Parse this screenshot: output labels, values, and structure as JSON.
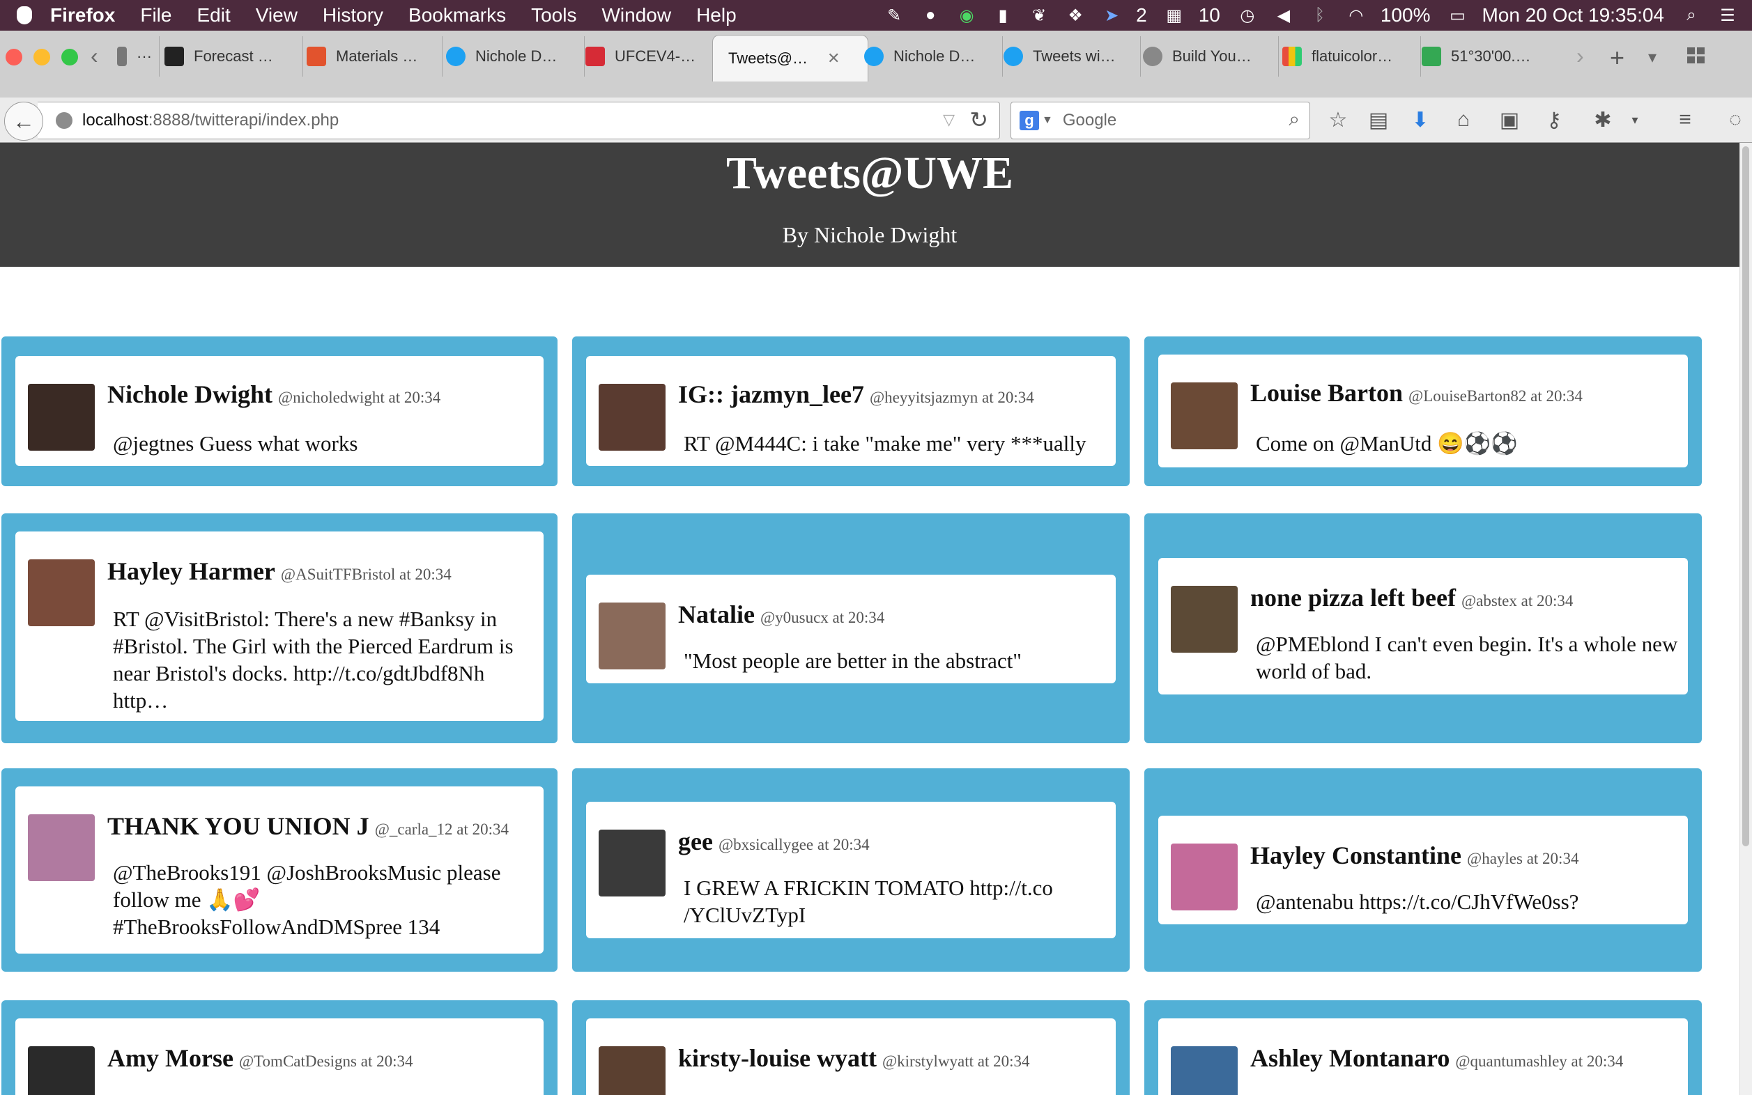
{
  "menubar": {
    "app": "Firefox",
    "menus": [
      "File",
      "Edit",
      "View",
      "History",
      "Bookmarks",
      "Tools",
      "Window",
      "Help"
    ],
    "tray_count_a": "2",
    "tray_count_b": "10",
    "battery": "100%",
    "clock": "Mon 20 Oct  19:35:04"
  },
  "tabs": [
    {
      "label": "···",
      "color": "#777777"
    },
    {
      "label": "Forecast …",
      "color": "#222222"
    },
    {
      "label": "Materials …",
      "color": "#e2532d"
    },
    {
      "label": "Nichole D…",
      "color": "#1da1f2"
    },
    {
      "label": "UFCEV4-…",
      "color": "#d62b36"
    },
    {
      "label": "Tweets@…",
      "color": "#ffffff"
    },
    {
      "label": "Nichole D…",
      "color": "#1da1f2"
    },
    {
      "label": "Tweets wi…",
      "color": "#1da1f2"
    },
    {
      "label": "Build You…",
      "color": "#888888"
    },
    {
      "label": "flatuicolor…",
      "color": "#e84c3d"
    },
    {
      "label": "51°30'00.…",
      "color": "#34a853"
    }
  ],
  "navbar": {
    "url_host": "localhost",
    "url_rest": ":8888/twitterapi/index.php",
    "search_placeholder": "Google"
  },
  "page": {
    "title": "Tweets@UWE",
    "byline": "By Nichole Dwight"
  },
  "tweets": [
    {
      "name": "Nichole Dwight",
      "meta": "@nicholedwight at 20:34",
      "text": "@jegtnes Guess what works",
      "avatar_color": "#3a2a24"
    },
    {
      "name": "IG:: jazmyn_lee7",
      "meta": "@heyyitsjazmyn at 20:34",
      "text": "RT @M444C: i take \"make me\" very ***ually",
      "avatar_color": "#5a3b30"
    },
    {
      "name": "Louise Barton",
      "meta": "@LouiseBarton82 at 20:34",
      "text": "Come on @ManUtd 😄⚽⚽",
      "avatar_color": "#6b4a36"
    },
    {
      "name": "Hayley Harmer",
      "meta": "@ASuitTFBristol at 20:34",
      "text": "RT @VisitBristol: There's a new #Banksy in #Bristol. The Girl with the Pierced Eardrum is near Bristol's docks. http://t.co/gdtJbdf8Nh http…",
      "avatar_color": "#7a4b3a"
    },
    {
      "name": "Natalie",
      "meta": "@y0usucx at 20:34",
      "text": "\"Most people are better in the abstract\"",
      "avatar_color": "#8a6a5a"
    },
    {
      "name": "none pizza left beef",
      "meta": "@abstex at 20:34",
      "text": "@PMEblond I can't even begin. It's a whole new world of bad.",
      "avatar_color": "#5c4a36"
    },
    {
      "name": "THANK YOU UNION J",
      "meta": "@_carla_12 at 20:34",
      "text": "@TheBrooks191 @JoshBrooksMusic please follow me 🙏💕#TheBrooksFollowAndDMSpree 134",
      "avatar_color": "#b07aa0"
    },
    {
      "name": "gee",
      "meta": "@bxsicallygee at 20:34",
      "text": "I GREW A FRICKIN TOMATO http://t.co /YClUvZTypI",
      "avatar_color": "#3a3a3a"
    },
    {
      "name": "Hayley Constantine",
      "meta": "@hayles at 20:34",
      "text": "@antenabu https://t.co/CJhVfWe0ss?",
      "avatar_color": "#c46a9a"
    },
    {
      "name": "Amy Morse",
      "meta": "@TomCatDesigns at 20:34",
      "text": "",
      "avatar_color": "#2a2a2a"
    },
    {
      "name": "kirsty-louise wyatt",
      "meta": "@kirstylwyatt at 20:34",
      "text": "",
      "avatar_color": "#5b4030"
    },
    {
      "name": "Ashley Montanaro",
      "meta": "@quantumashley at 20:34",
      "text": "",
      "avatar_color": "#3b6a9a"
    }
  ],
  "colors": {
    "tile": "#52b0d6",
    "header_bg": "#3f3f3f"
  }
}
